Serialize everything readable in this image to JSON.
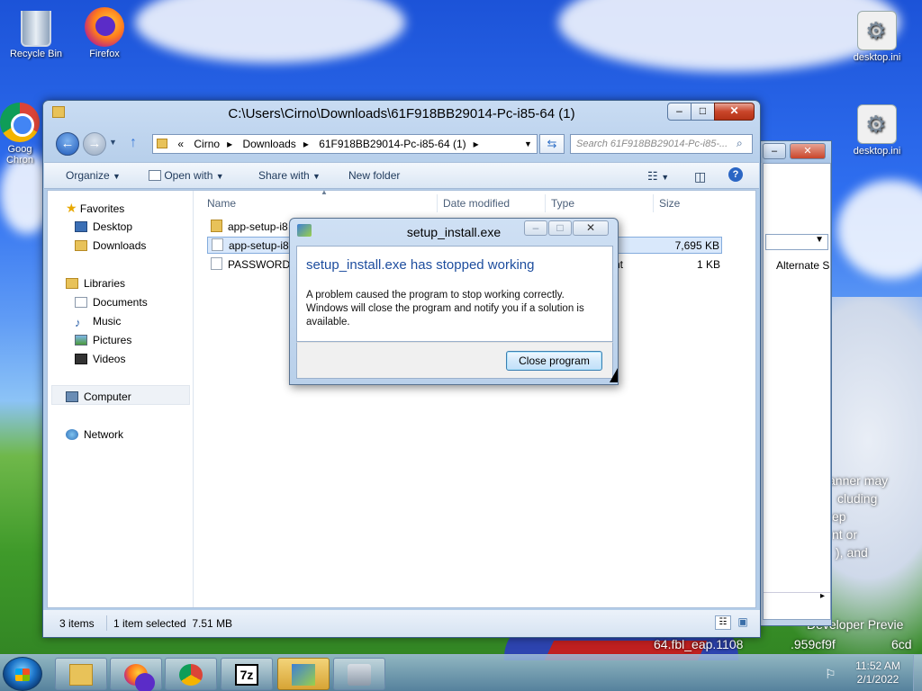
{
  "desktop": {
    "icons": [
      {
        "label": "Recycle Bin"
      },
      {
        "label": "Firefox"
      },
      {
        "label": "Goog Chron"
      },
      {
        "label": "desktop.ini"
      },
      {
        "label": "desktop.ini"
      }
    ],
    "wallpaper_text": [
      "anner may",
      "cluding",
      "ep",
      "nt or",
      "), and",
      "Developer Previe",
      "64.fbl_eap.1108",
      ".959cf9f",
      "6cd"
    ]
  },
  "back_window": {
    "dropdown_value": "",
    "column_label": "Alternate S",
    "minimize": "–",
    "close": "✕"
  },
  "explorer": {
    "title": "C:\\Users\\Cirno\\Downloads\\61F918BB29014-Pc-i85-64 (1)",
    "address": {
      "overflow": "«",
      "crumbs": [
        "Cirno",
        "Downloads",
        "61F918BB29014-Pc-i85-64 (1)"
      ]
    },
    "search_placeholder": "Search 61F918BB29014-Pc-i85-...",
    "toolbar": {
      "organize": "Organize",
      "open_with": "Open with",
      "share_with": "Share with",
      "new_folder": "New folder"
    },
    "nav": {
      "favorites": "Favorites",
      "desktop": "Desktop",
      "downloads": "Downloads",
      "libraries": "Libraries",
      "documents": "Documents",
      "music": "Music",
      "pictures": "Pictures",
      "videos": "Videos",
      "computer": "Computer",
      "network": "Network"
    },
    "columns": {
      "name": "Name",
      "date": "Date modified",
      "type": "Type",
      "size": "Size"
    },
    "files": [
      {
        "name": "app-setup-i8",
        "type": "",
        "size": ""
      },
      {
        "name": "app-setup-i8",
        "type": "",
        "size": "7,695 KB"
      },
      {
        "name": "PASSWORD-",
        "type": "nt",
        "size": "1 KB"
      }
    ],
    "status": {
      "count": "3 items",
      "selected": "1 item selected  7.51 MB"
    }
  },
  "dialog": {
    "title": "setup_install.exe",
    "heading": "setup_install.exe has stopped working",
    "message": "A problem caused the program to stop working correctly. Windows will close the program and notify you if a solution is available.",
    "button": "Close program"
  },
  "taskbar": {
    "time": "11:52 AM",
    "date": "2/1/2022",
    "seven_zip": "7z"
  }
}
